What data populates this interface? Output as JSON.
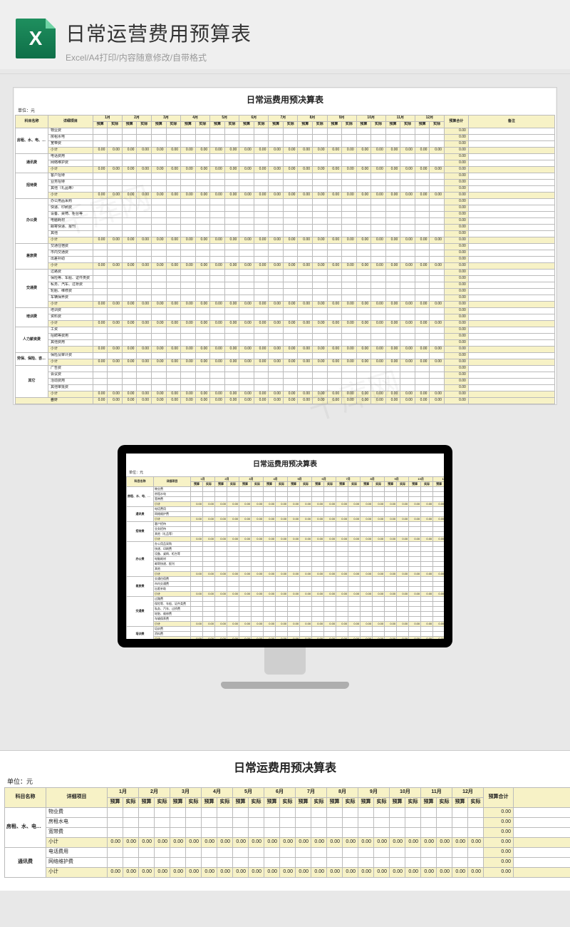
{
  "hero": {
    "title": "日常运营费用预算表",
    "subtitle": "Excel/A4打印/内容随意修改/自带格式"
  },
  "sheet": {
    "title": "日常运费用预决算表",
    "unit_label": "单位：元",
    "header": {
      "cat": "科目名称",
      "item": "详细项目",
      "months": [
        "1月",
        "2月",
        "3月",
        "4月",
        "5月",
        "6月",
        "7月",
        "8月",
        "9月",
        "10月",
        "11月",
        "12月"
      ],
      "subcols": [
        "预算",
        "实际"
      ],
      "total": "预算合计",
      "remark": "备注"
    },
    "zero": "0.00",
    "subtotal_label": "小计",
    "total_label": "合计",
    "groups": [
      {
        "cat": "房租、水、电、通讯费",
        "rows": [
          "物业费",
          "房租水电",
          "宽带费"
        ]
      },
      {
        "cat": "通讯费",
        "rows": [
          "电话费用",
          "网络维护费"
        ]
      },
      {
        "cat": "招待费",
        "rows": [
          "客户招待",
          "业务招待",
          "其他（礼品等）"
        ]
      },
      {
        "cat": "办公费",
        "rows": [
          "办公用品采购",
          "快递、印刷费",
          "设备、桌椅、柜台等",
          "电脑耗材",
          "邮寄快递、报刊",
          "其他"
        ]
      },
      {
        "cat": "差旅费",
        "rows": [
          "交通住宿费",
          "市内交通费",
          "出差补助"
        ]
      },
      {
        "cat": "交通费",
        "rows": [
          "过路费",
          "保险等、车船、证件类费",
          "私务、汽车、过桥费",
          "轮胎、维修费",
          "车辆保养费"
        ]
      },
      {
        "cat": "培训费",
        "rows": [
          "培训费",
          "资料费"
        ]
      },
      {
        "cat": "人力薪资费",
        "rows": [
          "工资",
          "招聘等费用",
          "其他费用"
        ]
      },
      {
        "cat": "劳保、保险、咨询审计费",
        "rows": [
          "保险及审计费"
        ]
      },
      {
        "cat": "其它",
        "rows": [
          "广告费",
          "会议费",
          "活动费用",
          "其他审批费"
        ]
      }
    ]
  },
  "watermark": "千库网"
}
